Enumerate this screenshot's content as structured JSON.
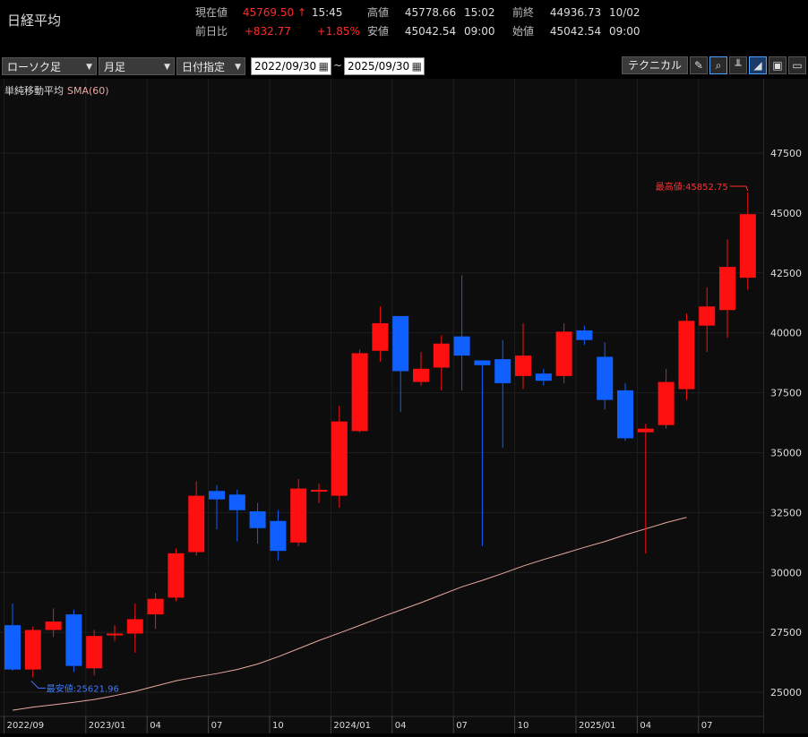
{
  "header": {
    "title": "日経平均",
    "current_label": "現在値",
    "current_value": "45769.50",
    "current_arrow": "↑",
    "current_time": "15:45",
    "change_label": "前日比",
    "change_value": "+832.77",
    "change_pct": "+1.85%",
    "high_label": "高値",
    "high_value": "45778.66",
    "high_time": "15:02",
    "low_label": "安値",
    "low_value": "45042.54",
    "low_time": "09:00",
    "prev_label": "前終",
    "prev_value": "44936.73",
    "prev_date": "10/02",
    "open_label": "始値",
    "open_value": "45042.54",
    "open_time": "09:00"
  },
  "toolbar": {
    "chart_type": "ローソク足",
    "period": "月足",
    "range_mode": "日付指定",
    "date_from": "2022/09/30",
    "tilde": "~",
    "date_to": "2025/09/30",
    "technical_label": "テクニカル"
  },
  "indicator": {
    "name": "単純移動平均",
    "param": "SMA(60)"
  },
  "colors": {
    "up": "#ff1010",
    "down": "#1060ff",
    "sma": "#e9a9a0",
    "background": "#0d0d0d",
    "grid": "#1f1f1f",
    "max_annotation": "#ff3030",
    "min_annotation": "#3a7bff"
  },
  "chart_data": {
    "type": "candlestick",
    "period": "monthly",
    "ylim": [
      23900,
      49700
    ],
    "y_ticks": [
      "47500",
      "45000",
      "42500",
      "40000",
      "37500",
      "35000",
      "32500",
      "30000",
      "27500",
      "25000"
    ],
    "y_tick_values": [
      47500,
      45000,
      42500,
      40000,
      37500,
      35000,
      32500,
      30000,
      27500,
      25000
    ],
    "x_tick_labels": [
      "2022/09",
      "2023/01",
      "04",
      "07",
      "10",
      "2024/01",
      "04",
      "07",
      "10",
      "2025/01",
      "04",
      "07"
    ],
    "x_tick_index": [
      0,
      4,
      7,
      10,
      13,
      16,
      19,
      22,
      25,
      28,
      31,
      34
    ],
    "candles": [
      {
        "o": 27800,
        "h": 28700,
        "l": 25900,
        "c": 25950
      },
      {
        "o": 25950,
        "h": 27750,
        "l": 25622,
        "c": 27600
      },
      {
        "o": 27600,
        "h": 28500,
        "l": 27300,
        "c": 27950
      },
      {
        "o": 28250,
        "h": 28450,
        "l": 25850,
        "c": 26100
      },
      {
        "o": 26000,
        "h": 27600,
        "l": 25700,
        "c": 27350
      },
      {
        "o": 27450,
        "h": 27800,
        "l": 27150,
        "c": 27450
      },
      {
        "o": 27450,
        "h": 28700,
        "l": 26650,
        "c": 28050
      },
      {
        "o": 28250,
        "h": 29150,
        "l": 27650,
        "c": 28900
      },
      {
        "o": 28950,
        "h": 31000,
        "l": 28800,
        "c": 30800
      },
      {
        "o": 30850,
        "h": 33800,
        "l": 30700,
        "c": 33200
      },
      {
        "o": 33400,
        "h": 33650,
        "l": 31800,
        "c": 33050
      },
      {
        "o": 33250,
        "h": 33450,
        "l": 31300,
        "c": 32600
      },
      {
        "o": 32550,
        "h": 32900,
        "l": 31200,
        "c": 31850
      },
      {
        "o": 32150,
        "h": 32600,
        "l": 30500,
        "c": 30900
      },
      {
        "o": 31250,
        "h": 33900,
        "l": 31100,
        "c": 33500
      },
      {
        "o": 33450,
        "h": 33700,
        "l": 32900,
        "c": 33450
      },
      {
        "o": 33200,
        "h": 36950,
        "l": 32700,
        "c": 36300
      },
      {
        "o": 35900,
        "h": 39300,
        "l": 35850,
        "c": 39150
      },
      {
        "o": 39250,
        "h": 41100,
        "l": 38800,
        "c": 40400
      },
      {
        "o": 40700,
        "h": 40650,
        "l": 36700,
        "c": 38400
      },
      {
        "o": 37950,
        "h": 39200,
        "l": 37800,
        "c": 38500
      },
      {
        "o": 38550,
        "h": 39900,
        "l": 37600,
        "c": 39550
      },
      {
        "o": 39850,
        "h": 42400,
        "l": 37600,
        "c": 39050
      },
      {
        "o": 38850,
        "h": 38750,
        "l": 31100,
        "c": 38650
      },
      {
        "o": 38900,
        "h": 39700,
        "l": 35200,
        "c": 37900
      },
      {
        "o": 38200,
        "h": 40400,
        "l": 37650,
        "c": 39050
      },
      {
        "o": 38300,
        "h": 38500,
        "l": 37800,
        "c": 38000
      },
      {
        "o": 38200,
        "h": 40400,
        "l": 37900,
        "c": 40050
      },
      {
        "o": 40100,
        "h": 40300,
        "l": 39500,
        "c": 39700
      },
      {
        "o": 39000,
        "h": 39600,
        "l": 36800,
        "c": 37200
      },
      {
        "o": 37600,
        "h": 37900,
        "l": 35500,
        "c": 35600
      },
      {
        "o": 35850,
        "h": 36200,
        "l": 30792,
        "c": 36000
      },
      {
        "o": 36150,
        "h": 38500,
        "l": 36000,
        "c": 37950
      },
      {
        "o": 37650,
        "h": 40800,
        "l": 37200,
        "c": 40500
      },
      {
        "o": 40300,
        "h": 41900,
        "l": 39200,
        "c": 41100
      },
      {
        "o": 40950,
        "h": 43900,
        "l": 39800,
        "c": 42750
      },
      {
        "o": 42300,
        "h": 45853,
        "l": 41800,
        "c": 44950
      }
    ],
    "sma60": [
      24250,
      24380,
      24480,
      24580,
      24700,
      24860,
      25040,
      25260,
      25480,
      25640,
      25780,
      25950,
      26180,
      26480,
      26820,
      27160,
      27470,
      27790,
      28120,
      28430,
      28740,
      29070,
      29400,
      29670,
      29960,
      30270,
      30540,
      30790,
      31050,
      31290,
      31570,
      31820,
      32080,
      32300
    ],
    "max_label": "最高値:45852.75",
    "min_label": "最安値:25621.96"
  }
}
